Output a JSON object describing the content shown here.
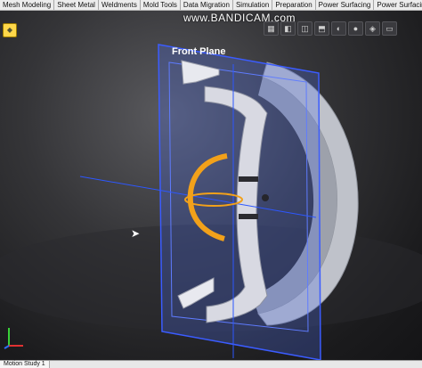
{
  "toolbar": {
    "tabs": [
      "Mesh Modeling",
      "Sheet Metal",
      "Weldments",
      "Mold Tools",
      "Data Migration",
      "Simulation",
      "Preparation",
      "Power Surfacing",
      "Power Surfacing"
    ],
    "icons": [
      "select-icon",
      "view-icon",
      "display-icon",
      "section-icon",
      "scene-icon",
      "appearance-icon",
      "render-icon",
      "monitor-icon"
    ]
  },
  "watermark": "www.BANDICAM.com",
  "viewport": {
    "plane_label": "Front Plane"
  },
  "bottom": {
    "tab_label": "Motion Study 1"
  },
  "colors": {
    "plane_fill": "#4a6be8",
    "plane_edge": "#3b5cff",
    "rotation_handle": "#f2a11a",
    "wheel_body": "#c9ccd6"
  }
}
